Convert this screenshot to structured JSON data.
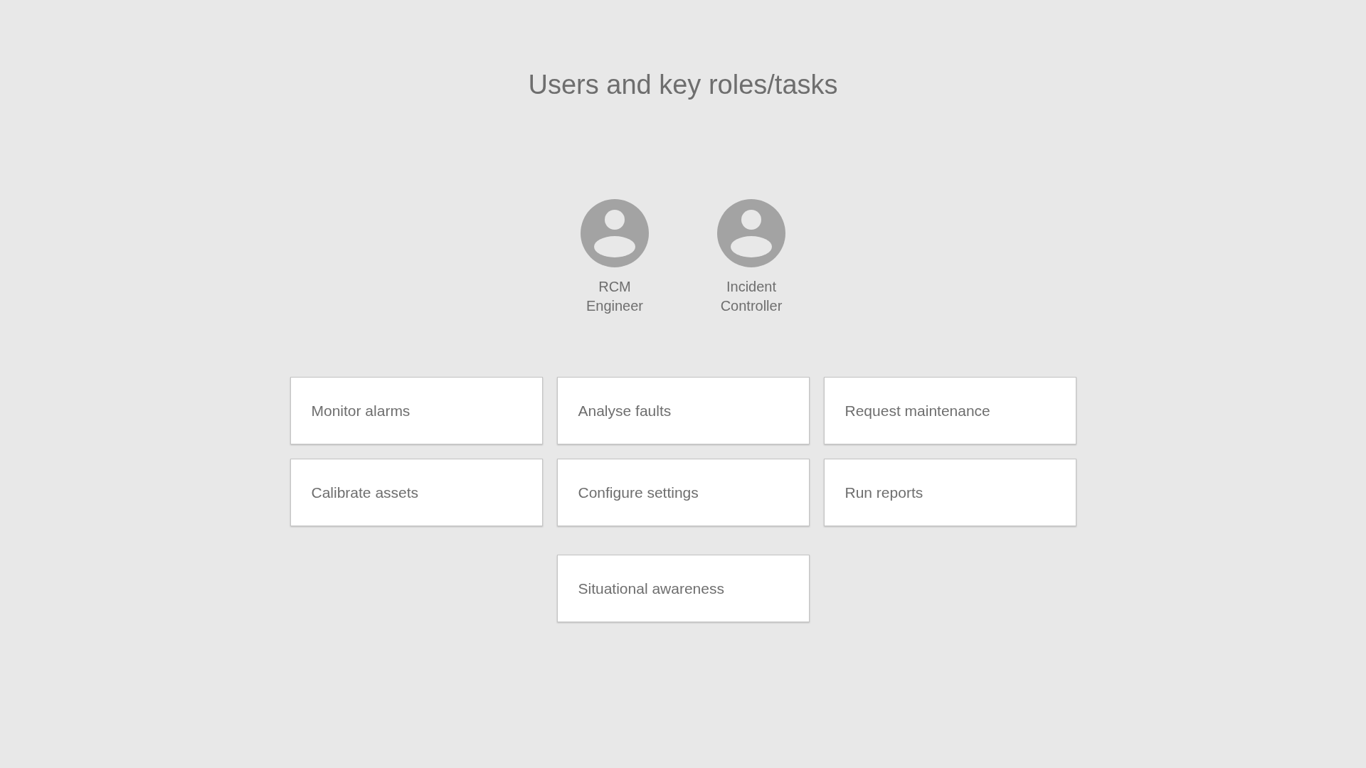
{
  "title": "Users and key roles/tasks",
  "users": [
    {
      "name": "RCM Engineer"
    },
    {
      "name": "Incident Controller"
    }
  ],
  "task_rows": [
    {
      "tasks": [
        "Monitor alarms",
        "Analyse faults",
        "Request maintenance"
      ]
    },
    {
      "tasks": [
        "Calibrate assets",
        "Configure settings",
        "Run reports"
      ]
    },
    {
      "tasks": [
        "Situational awareness"
      ]
    }
  ]
}
